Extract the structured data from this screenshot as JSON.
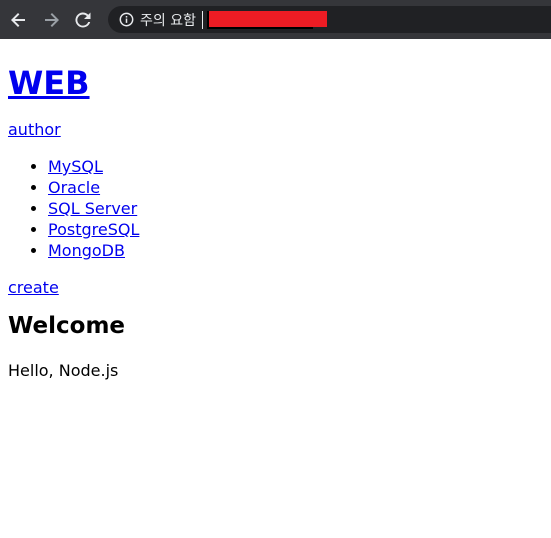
{
  "browser": {
    "nav_icons": [
      "back-arrow-icon",
      "forward-arrow-icon",
      "reload-icon",
      "info-icon"
    ],
    "security_label": "주의 요함",
    "toolbar_color": "#35363a",
    "omnibox_color": "#202124",
    "redaction_color": "#ed1c24"
  },
  "page": {
    "title": "WEB",
    "author_link": "author",
    "databases": [
      {
        "label": "MySQL"
      },
      {
        "label": "Oracle"
      },
      {
        "label": "SQL Server"
      },
      {
        "label": "PostgreSQL"
      },
      {
        "label": "MongoDB"
      }
    ],
    "create_link": "create",
    "heading": "Welcome",
    "body": "Hello, Node.js",
    "link_color": "#0000ee"
  }
}
